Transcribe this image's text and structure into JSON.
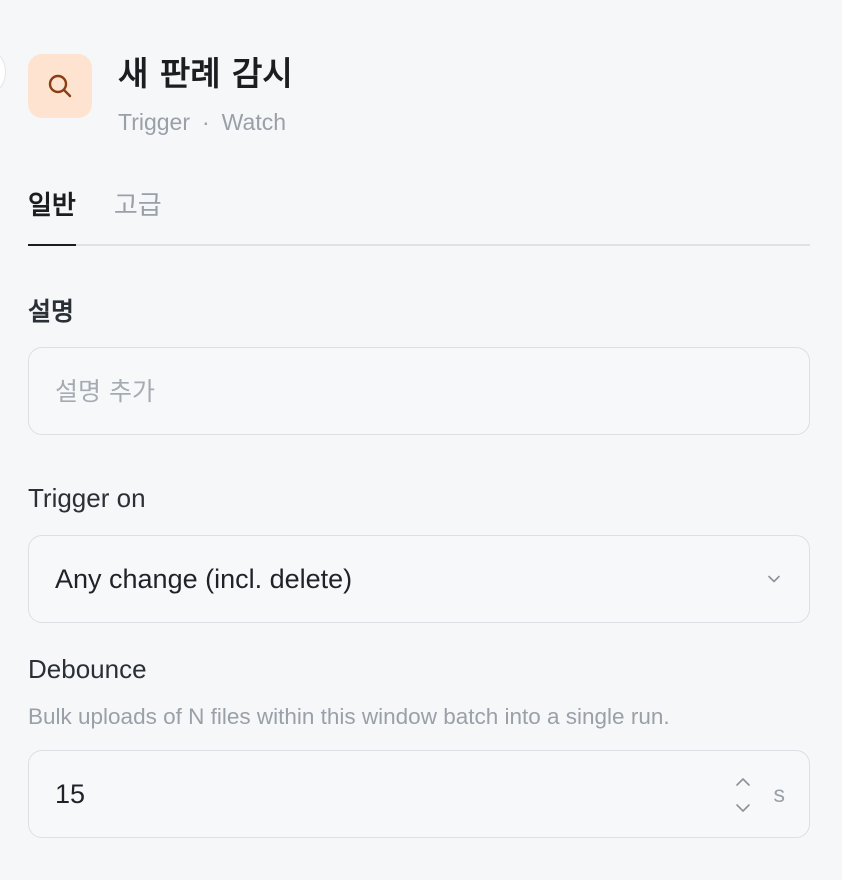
{
  "header": {
    "title": "새 판례 감시",
    "subtitle_type": "Trigger",
    "subtitle_separator": "·",
    "subtitle_kind": "Watch",
    "icon": "search-icon",
    "accent_bg": "#fde3d0"
  },
  "tabs": [
    {
      "label": "일반",
      "active": true
    },
    {
      "label": "고급",
      "active": false
    }
  ],
  "description": {
    "label": "설명",
    "value": "",
    "placeholder": "설명 추가"
  },
  "trigger_on": {
    "label": "Trigger on",
    "selected": "Any change (incl. delete)"
  },
  "debounce": {
    "label": "Debounce",
    "help": "Bulk uploads of N files within this window batch into a single run.",
    "value": "15",
    "unit": "s"
  }
}
